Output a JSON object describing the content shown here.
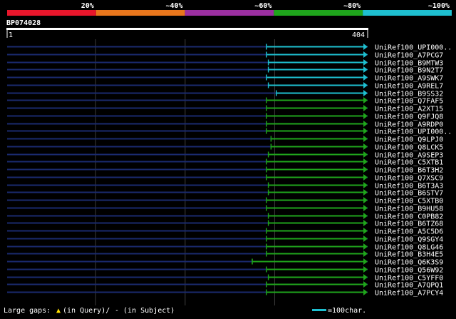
{
  "query": {
    "name": "BP074028",
    "start": "1",
    "end": "404",
    "length": 404
  },
  "identity_scale": {
    "labels": [
      "20%",
      "~40%",
      "~60%",
      "~80%",
      "~100%"
    ],
    "colors": [
      "#e8162b",
      "#e8761c",
      "#9b2fa0",
      "#1fa51c",
      "#1ebfd0"
    ]
  },
  "colors": {
    "background": "#000000",
    "track": "#1a2a6e",
    "grid": "#3a3a3a",
    "cyan": "#1ebfd0",
    "green": "#1fa51c"
  },
  "hits": [
    {
      "name": "UniRef100_UPI000..",
      "start": 291,
      "end": 404,
      "color": "cyan"
    },
    {
      "name": "UniRef100_A7PCG7",
      "start": 291,
      "end": 404,
      "color": "cyan"
    },
    {
      "name": "UniRef100_B9MTW3",
      "start": 293,
      "end": 404,
      "color": "cyan"
    },
    {
      "name": "UniRef100_B9N2T7",
      "start": 293,
      "end": 404,
      "color": "cyan"
    },
    {
      "name": "UniRef100_A9SWK7",
      "start": 291,
      "end": 404,
      "color": "cyan"
    },
    {
      "name": "UniRef100_A9REL7",
      "start": 293,
      "end": 404,
      "color": "cyan"
    },
    {
      "name": "UniRef100_B9SS32",
      "start": 302,
      "end": 404,
      "color": "cyan"
    },
    {
      "name": "UniRef100_Q7FAF5",
      "start": 291,
      "end": 404,
      "color": "green"
    },
    {
      "name": "UniRef100_A2XT15",
      "start": 291,
      "end": 404,
      "color": "green"
    },
    {
      "name": "UniRef100_Q9FJQ8",
      "start": 291,
      "end": 404,
      "color": "green"
    },
    {
      "name": "UniRef100_A9RDP0",
      "start": 291,
      "end": 404,
      "color": "green"
    },
    {
      "name": "UniRef100_UPI000..",
      "start": 291,
      "end": 404,
      "color": "green"
    },
    {
      "name": "UniRef100_Q9LPJ0",
      "start": 296,
      "end": 404,
      "color": "green"
    },
    {
      "name": "UniRef100_Q8LCK5",
      "start": 296,
      "end": 404,
      "color": "green"
    },
    {
      "name": "UniRef100_A9SEP3",
      "start": 293,
      "end": 404,
      "color": "green"
    },
    {
      "name": "UniRef100_C5XTB1",
      "start": 291,
      "end": 404,
      "color": "green"
    },
    {
      "name": "UniRef100_B6T3H2",
      "start": 291,
      "end": 404,
      "color": "green"
    },
    {
      "name": "UniRef100_Q7XSC9",
      "start": 291,
      "end": 404,
      "color": "green"
    },
    {
      "name": "UniRef100_B6T3A3",
      "start": 293,
      "end": 404,
      "color": "green"
    },
    {
      "name": "UniRef100_B6STV7",
      "start": 293,
      "end": 404,
      "color": "green"
    },
    {
      "name": "UniRef100_C5XTB0",
      "start": 291,
      "end": 404,
      "color": "green"
    },
    {
      "name": "UniRef100_B9HU58",
      "start": 291,
      "end": 404,
      "color": "green"
    },
    {
      "name": "UniRef100_C0PB82",
      "start": 293,
      "end": 404,
      "color": "green"
    },
    {
      "name": "UniRef100_B6TZ68",
      "start": 293,
      "end": 404,
      "color": "green"
    },
    {
      "name": "UniRef100_A5C5D6",
      "start": 291,
      "end": 404,
      "color": "green"
    },
    {
      "name": "UniRef100_Q9SGY4",
      "start": 291,
      "end": 404,
      "color": "green"
    },
    {
      "name": "UniRef100_Q8LG46",
      "start": 291,
      "end": 404,
      "color": "green"
    },
    {
      "name": "UniRef100_B3H4E5",
      "start": 291,
      "end": 404,
      "color": "green"
    },
    {
      "name": "UniRef100_Q6K3S9",
      "start": 275,
      "end": 404,
      "color": "green"
    },
    {
      "name": "UniRef100_Q56W92",
      "start": 291,
      "end": 404,
      "color": "green"
    },
    {
      "name": "UniRef100_C5YFF0",
      "start": 293,
      "end": 404,
      "color": "green"
    },
    {
      "name": "UniRef100_A7QPQ1",
      "start": 291,
      "end": 404,
      "color": "green"
    },
    {
      "name": "UniRef100_A7PCY4",
      "start": 291,
      "end": 404,
      "color": "green"
    }
  ],
  "footer": {
    "gaps_prefix": "Large gaps:",
    "gaps_query": "(in Query)/",
    "gaps_subject": "- (in Subject)",
    "scale_label": "=100char."
  }
}
